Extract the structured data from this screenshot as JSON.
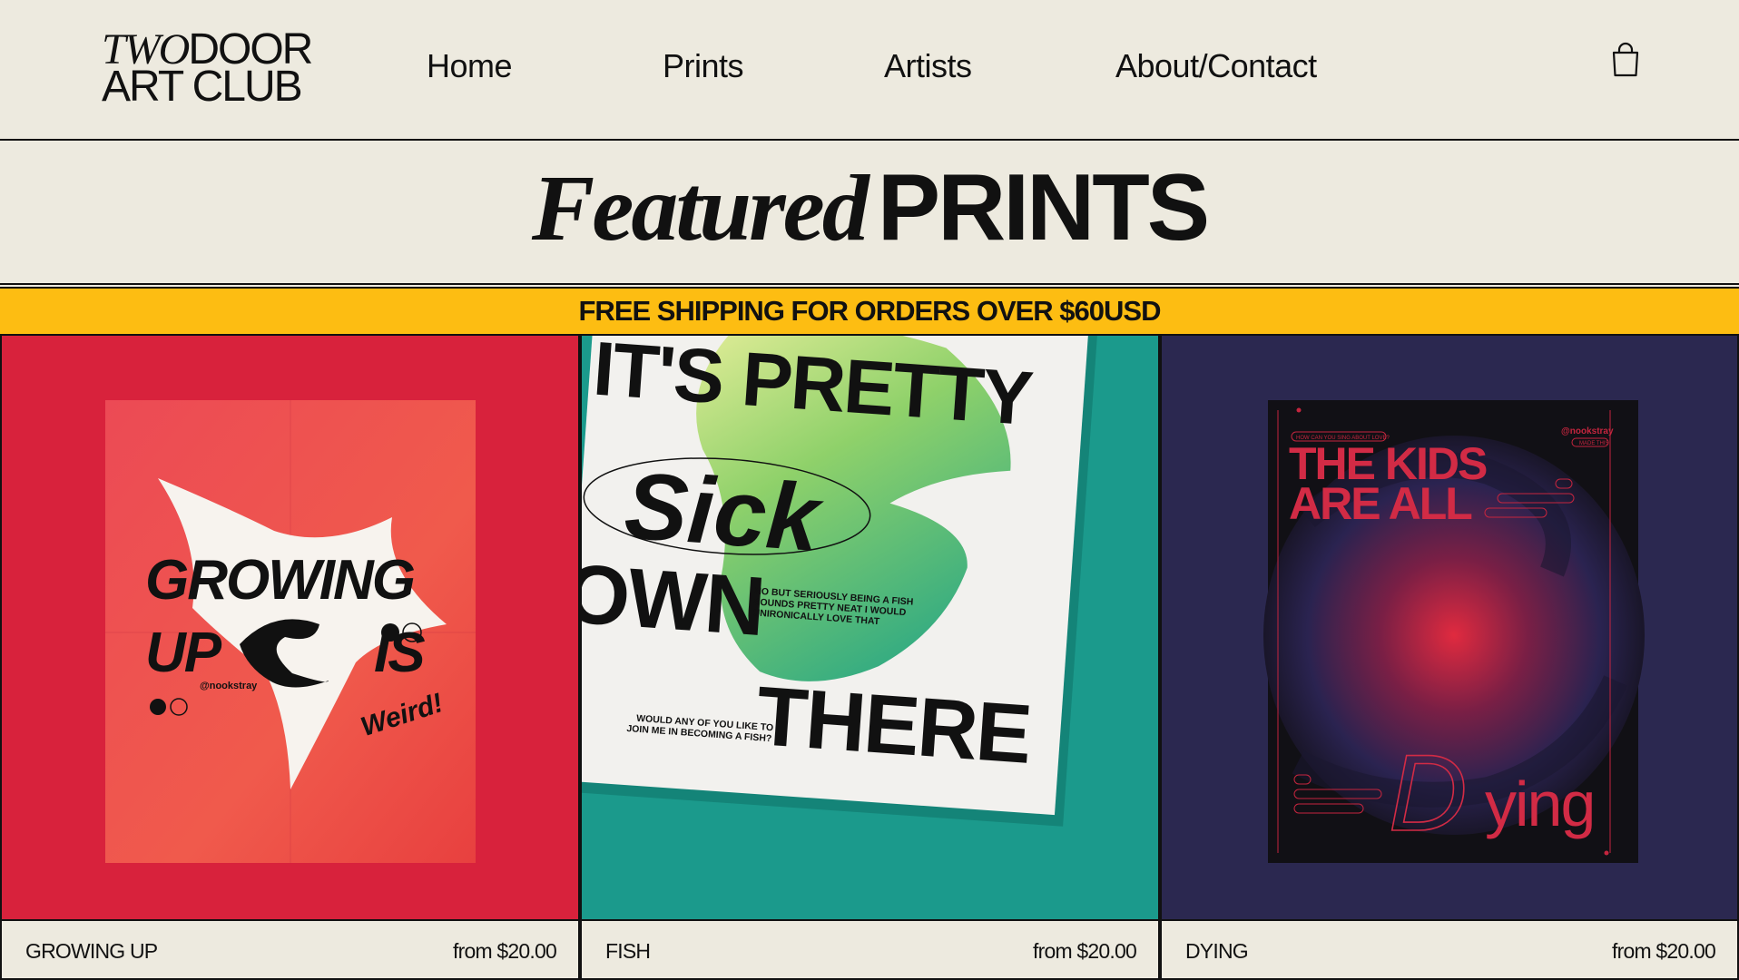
{
  "brand": {
    "logo_word_1": "TWO",
    "logo_word_2": "DOOR",
    "logo_line_2": "ART CLUB"
  },
  "nav": {
    "items": [
      {
        "label": "Home"
      },
      {
        "label": "Prints"
      },
      {
        "label": "Artists"
      },
      {
        "label": "About/Contact"
      }
    ],
    "cart_icon": "shopping-bag-icon"
  },
  "section": {
    "title_italic": "Featured",
    "title_bold": "PRINTS"
  },
  "banner": {
    "text": "FREE SHIPPING FOR ORDERS OVER $60USD"
  },
  "products": [
    {
      "name": "GROWING UP",
      "price": "from $20.00",
      "background": "#d8223c",
      "poster": {
        "line1": "GROWING",
        "line2a": "UP",
        "line2b": "IS",
        "script": "Weird!",
        "credit": "@nookstray"
      }
    },
    {
      "name": "FISH",
      "price": "from $20.00",
      "background": "#1b9a8c",
      "poster": {
        "line1": "IT'S PRETTY",
        "script": "Sick",
        "line3": "OWN",
        "line4": "THERE",
        "note": [
          "NO BUT SERIOUSLY BEING A FISH",
          "SOUNDS PRETTY NEAT I WOULD",
          "UNIRONICALLY LOVE THAT"
        ],
        "question": [
          "WOULD ANY OF YOU LIKE TO",
          "JOIN ME IN BECOMING A FISH?"
        ]
      }
    },
    {
      "name": "DYING",
      "price": "from $20.00",
      "background": "#2b2850",
      "poster": {
        "small_tag": "HOW CAN YOU SING ABOUT LOVE?",
        "credit": "@nookstray",
        "credit_sub": "MADE THIS",
        "line1": "THE KIDS",
        "line2": "ARE ALL",
        "script_letter": "D",
        "tail": "ying"
      }
    }
  ],
  "colors": {
    "page_background": "#edeadf",
    "banner": "#fdbd12",
    "text": "#111111"
  }
}
